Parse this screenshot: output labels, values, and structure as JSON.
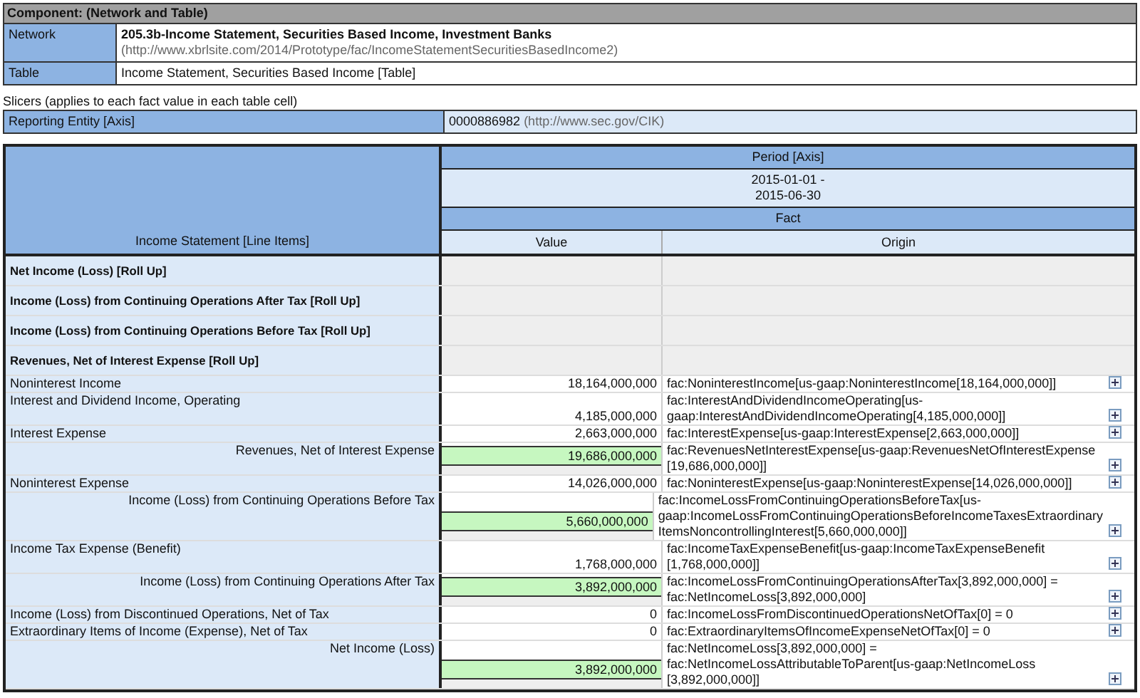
{
  "component": {
    "title": "Component: (Network and Table)",
    "network_label": "Network",
    "network_name": "205.3b-Income Statement, Securities Based Income, Investment Banks",
    "network_url": "(http://www.xbrlsite.com/2014/Prototype/fac/IncomeStatementSecuritiesBasedIncome2)",
    "table_label": "Table",
    "table_name": "Income Statement, Securities Based Income [Table]"
  },
  "slicers": {
    "caption": "Slicers (applies to each fact value in each table cell)",
    "axis": "Reporting Entity [Axis]",
    "value": "0000886982",
    "url": "(http://www.sec.gov/CIK)"
  },
  "table": {
    "period_axis": "Period [Axis]",
    "period": [
      "2015-01-01 -",
      "2015-06-30"
    ],
    "fact": "Fact",
    "line_items": "Income Statement [Line Items]",
    "value_header": "Value",
    "origin_header": "Origin",
    "rows": [
      {
        "kind": "rollup",
        "label": "Net Income (Loss) [Roll Up]"
      },
      {
        "kind": "rollup",
        "label": "Income (Loss) from Continuing Operations After Tax [Roll Up]"
      },
      {
        "kind": "rollup",
        "label": "Income (Loss) from Continuing Operations Before Tax [Roll Up]"
      },
      {
        "kind": "rollup",
        "label": "Revenues, Net of Interest Expense [Roll Up]"
      },
      {
        "kind": "item",
        "label": "Noninterest Income",
        "value": "18,164,000,000",
        "origin": [
          "fac:NoninterestIncome[us-gaap:NoninterestIncome[18,164,000,000]]"
        ]
      },
      {
        "kind": "item",
        "label": "Interest and Dividend Income, Operating",
        "value": "4,185,000,000",
        "origin": [
          "fac:InterestAndDividendIncomeOperating[us-",
          "gaap:InterestAndDividendIncomeOperating[4,185,000,000]]"
        ]
      },
      {
        "kind": "item",
        "label": "Interest Expense",
        "value": "2,663,000,000",
        "origin": [
          "fac:InterestExpense[us-gaap:InterestExpense[2,663,000,000]]"
        ]
      },
      {
        "kind": "total",
        "label": "Revenues, Net of Interest Expense",
        "value": "19,686,000,000",
        "origin": [
          "fac:RevenuesNetInterestExpense[us-gaap:RevenuesNetOfInterestExpense",
          "[19,686,000,000]]"
        ]
      },
      {
        "kind": "item",
        "label": "Noninterest Expense",
        "value": "14,026,000,000",
        "origin": [
          "fac:NoninterestExpense[us-gaap:NoninterestExpense[14,026,000,000]]"
        ]
      },
      {
        "kind": "total",
        "label": "Income (Loss) from Continuing Operations Before Tax",
        "value": "5,660,000,000",
        "origin": [
          "fac:IncomeLossFromContinuingOperationsBeforeTax[us-",
          "gaap:IncomeLossFromContinuingOperationsBeforeIncomeTaxesExtraordinary",
          "ItemsNoncontrollingInterest[5,660,000,000]]"
        ]
      },
      {
        "kind": "item",
        "label": "Income Tax Expense (Benefit)",
        "value": "1,768,000,000",
        "origin": [
          "fac:IncomeTaxExpenseBenefit[us-gaap:IncomeTaxExpenseBenefit",
          "[1,768,000,000]]"
        ]
      },
      {
        "kind": "total",
        "label": "Income (Loss) from Continuing Operations After Tax",
        "value": "3,892,000,000",
        "origin": [
          "fac:IncomeLossFromContinuingOperationsAfterTax[3,892,000,000] =",
          "fac:NetIncomeLoss[3,892,000,000]"
        ]
      },
      {
        "kind": "item",
        "label": "Income (Loss) from Discontinued Operations, Net of Tax",
        "value": "0",
        "origin": [
          "fac:IncomeLossFromDiscontinuedOperationsNetOfTax[0] = 0"
        ]
      },
      {
        "kind": "item",
        "label": "Extraordinary Items of Income (Expense), Net of Tax",
        "value": "0",
        "origin": [
          "fac:ExtraordinaryItemsOfIncomeExpenseNetOfTax[0] = 0"
        ]
      },
      {
        "kind": "total",
        "label": "Net Income (Loss)",
        "value": "3,892,000,000",
        "origin": [
          "fac:NetIncomeLoss[3,892,000,000] =",
          "fac:NetIncomeLossAttributableToParent[us-gaap:NetIncomeLoss",
          "[3,892,000,000]]"
        ]
      }
    ]
  }
}
